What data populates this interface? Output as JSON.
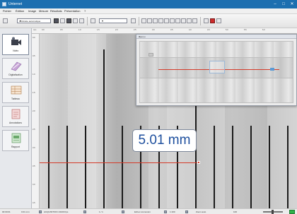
{
  "window": {
    "title": "Unternet"
  },
  "menu": {
    "items": [
      "Fichier",
      "Édition",
      "Image",
      "Mesure",
      "Résultats",
      "Présentation",
      "?"
    ]
  },
  "toolbar": {
    "combo1": "Contraste automatique",
    "combo2": ""
  },
  "sidebar": {
    "items": [
      {
        "label": "Vidéo",
        "icon": "video-camera-icon",
        "active": true
      },
      {
        "label": "Digitalisation",
        "icon": "digitize-icon",
        "active": false
      },
      {
        "label": "Tableau",
        "icon": "table-icon",
        "active": false
      },
      {
        "label": "Annotations",
        "icon": "annotations-icon",
        "active": false
      },
      {
        "label": "Rapport",
        "icon": "report-icon",
        "active": false
      }
    ]
  },
  "ruler": {
    "top_ticks": [
      "mm",
      "0.0",
      "0.5",
      "1.0",
      "1.5",
      "2.0",
      "2.5",
      "3.0",
      "3.5",
      "4.0",
      "4.5",
      "5.0",
      "5.5",
      "6.0"
    ],
    "left_ticks": [
      "0.0",
      "0.5",
      "1.0",
      "1.5",
      "2.0",
      "2.5",
      "3.0",
      "3.5",
      "4.0",
      "4.5"
    ]
  },
  "measurement": {
    "label": "5.01 mm",
    "line_color": "#d43b2a"
  },
  "overview": {
    "title": "Aperçu"
  },
  "statusbar": {
    "items": [
      "00:00:01",
      "0.01 mm",
      "ACQUISITION 1/1000 fps",
      "1 / 1",
      "Echec connexion",
      "1:100",
      "Zoom auto",
      "100"
    ]
  },
  "colors": {
    "titlebar": "#1d6fb0",
    "accent": "#cc2b2b",
    "measurement_text": "#1e4f9e",
    "status_ok": "#2fb34a"
  }
}
